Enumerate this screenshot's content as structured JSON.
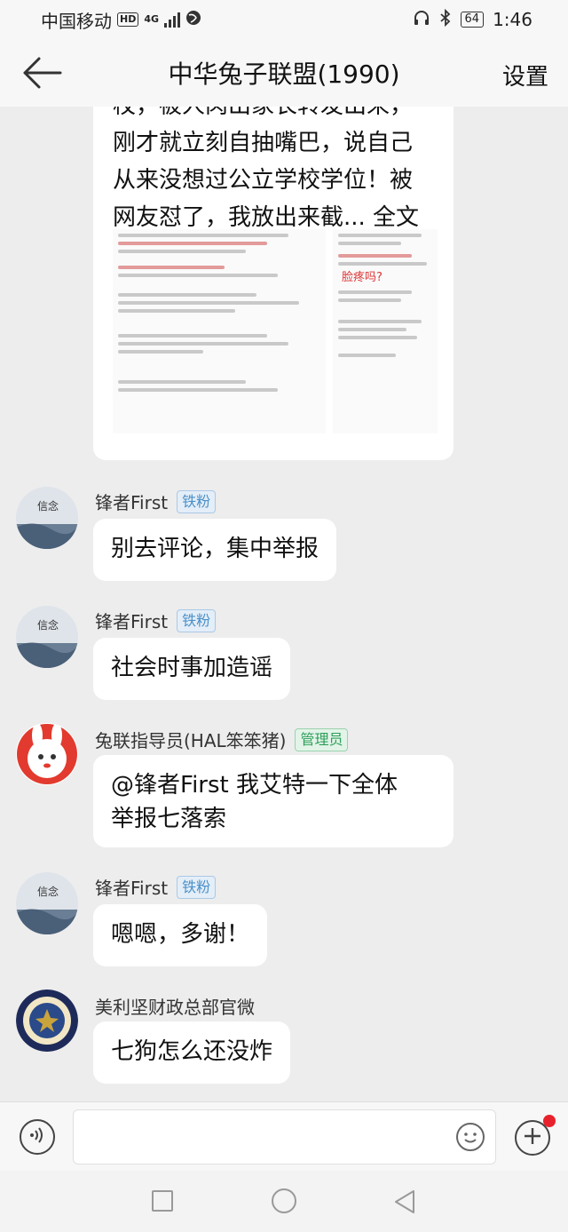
{
  "status_bar": {
    "carrier": "中国移动",
    "hd": "HD",
    "network": "4G",
    "battery": "64",
    "time": "1:46"
  },
  "header": {
    "title": "中华兔子联盟(1990)",
    "settings_label": "设置"
  },
  "post": {
    "lines": [
      "校，被人肉出家长转发出来，",
      "刚才就立刻自抽嘴巴，说自己",
      "从来没想过公立学校学位！被",
      "网友怼了，我放出来截... 全文"
    ],
    "image_caption": "脸疼吗?"
  },
  "messages": [
    {
      "sender": "锋者First",
      "badge": "铁粉",
      "badge_type": "fan",
      "text": "别去评论，集中举报",
      "avatar": "book-cover"
    },
    {
      "sender": "锋者First",
      "badge": "铁粉",
      "badge_type": "fan",
      "text": "社会时事加造谣",
      "avatar": "book-cover"
    },
    {
      "sender": "兔联指导员(HAL笨笨猪)",
      "badge": "管理员",
      "badge_type": "admin",
      "text": "@锋者First 我艾特一下全体举报七落索",
      "text_lines": [
        "@锋者First 我艾特一下全体",
        "举报七落索"
      ],
      "avatar": "rabbit-cartoon"
    },
    {
      "sender": "锋者First",
      "badge": "铁粉",
      "badge_type": "fan",
      "text": "嗯嗯，多谢！",
      "avatar": "book-cover"
    },
    {
      "sender": "美利坚财政总部官微",
      "badge": "",
      "badge_type": "",
      "text": "七狗怎么还没炸",
      "avatar": "department-seal"
    }
  ],
  "colors": {
    "background": "#ededed",
    "bubble": "#ffffff",
    "fan_badge": "#4a90c8",
    "admin_badge": "#2e9e5a",
    "notification_dot": "#e8222d"
  }
}
